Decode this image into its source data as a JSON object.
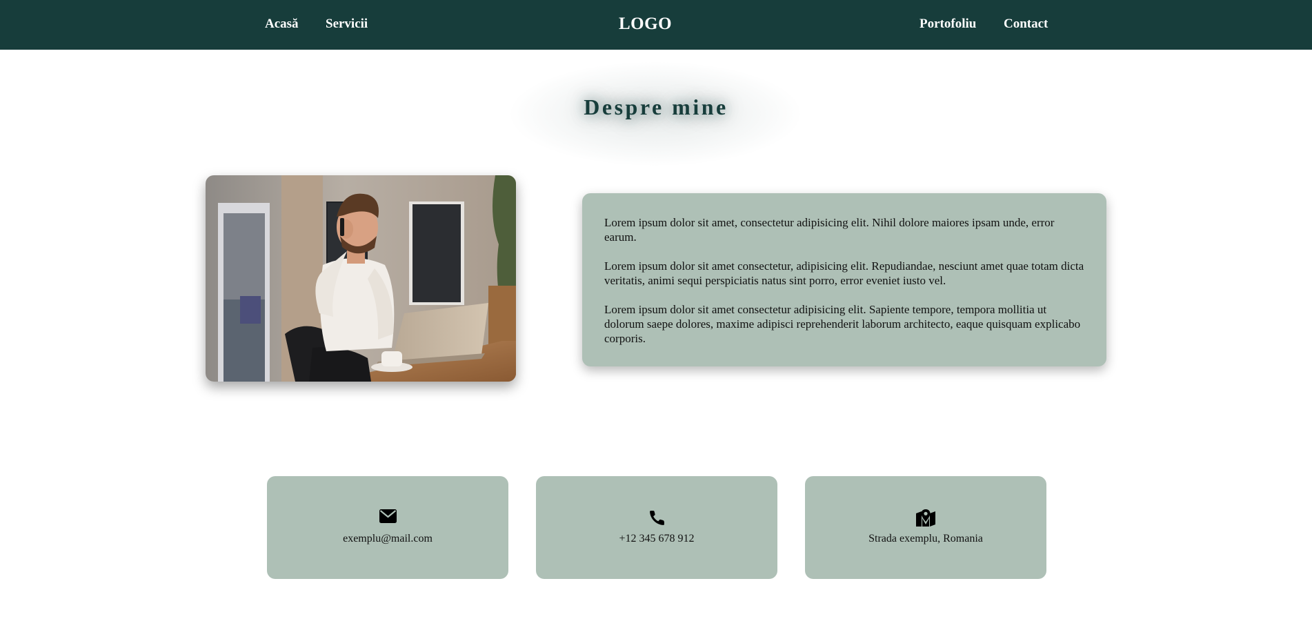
{
  "nav": {
    "left_links": [
      "Acasă",
      "Servicii"
    ],
    "logo": "LOGO",
    "right_links": [
      "Portofoliu",
      "Contact"
    ]
  },
  "about": {
    "title": "Despre mine",
    "paragraphs": [
      "Lorem ipsum dolor sit amet, consectetur adipisicing elit. Nihil dolore maiores ipsam unde, error earum.",
      "Lorem ipsum dolor sit amet consectetur, adipisicing elit. Repudiandae, nesciunt amet quae totam dicta veritatis, animi sequi perspiciatis natus sint porro, error eveniet iusto vel.",
      "Lorem ipsum dolor sit amet consectetur adipisicing elit. Sapiente tempore, tempora mollitia ut dolorum saepe dolores, maxime adipisci reprehenderit laborum architecto, eaque quisquam explicabo corporis."
    ]
  },
  "contacts": [
    {
      "icon": "envelope-icon",
      "text": "exemplu@mail.com"
    },
    {
      "icon": "phone-icon",
      "text": "+12 345 678 912"
    },
    {
      "icon": "map-icon",
      "text": "Strada exemplu, Romania"
    }
  ],
  "colors": {
    "nav_bg": "#173d3b",
    "card_bg": "#aec0b6",
    "title": "#173d3b"
  }
}
